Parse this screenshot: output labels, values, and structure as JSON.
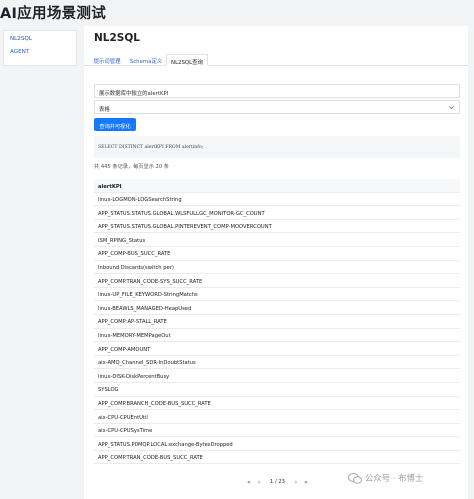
{
  "app": {
    "title": "AI应用场景测试"
  },
  "sidebar": {
    "items": [
      {
        "label": "NL2SQL"
      },
      {
        "label": "AGENT"
      }
    ]
  },
  "page": {
    "title": "NL2SQL"
  },
  "tabs": [
    {
      "label": "提示词管理"
    },
    {
      "label": "Schema定义"
    },
    {
      "label": "NL2SQL查询"
    }
  ],
  "query": {
    "value": "展示数据库中独立的alertKPI"
  },
  "display": {
    "selected": "表格"
  },
  "run_button": {
    "label": "查询并可视化"
  },
  "sql": {
    "text": "SELECT DISTINCT alertKPI FROM alertinfo;"
  },
  "summary": {
    "text": "共 445 条记录，每页显示 20 条"
  },
  "table": {
    "header": "alertKPI",
    "rows": [
      "linux-LOGMON-LOGSearchString",
      "APP_STATUS.STATUS.GLOBAL.WLSFULLGC_MONITOR-GC_COUNT",
      "APP_STATUS.STATUS.GLOBAL.PINTEREVENT_COMP-MOOVERCOUNT",
      "ISM_RPING_Status",
      "APP_COMP-BUS_SUCC_RATE",
      "Inbound Discards(switch per)",
      "APP_COMP.TRAN_CODE-SYS_SUCC_RATE",
      "linux-UP_FILE_KEYWORD-StringMatchs",
      "linux-BEAWLS_MANAGED-HeapUsed",
      "APP_COMP:AP-STALL_RATE",
      "linux-MEMORY-MEMPageOut",
      "APP_COMP-AMOUNT",
      "aix-AMQ_Channel_SDR-InDoubtStatus",
      "linux-DISK-DiskPercentBusy",
      "SYSLOG",
      "APP_COMP.BRANCH_CODE-BUS_SUCC_RATE",
      "aix-CPU-CPUEntUtil",
      "aix-CPU-CPUSysTime",
      "APP_STATUS.P0MQP.LOCAL:exchange-BytesDropped",
      "APP_COMP.TRAN_CODE-BUS_SUCC_RATE"
    ]
  },
  "pager": {
    "first": "«",
    "prev": "‹",
    "page_text": "1 / 23",
    "next": "›",
    "last": "»"
  },
  "watermark": {
    "text": "公众号 · 布博士"
  }
}
